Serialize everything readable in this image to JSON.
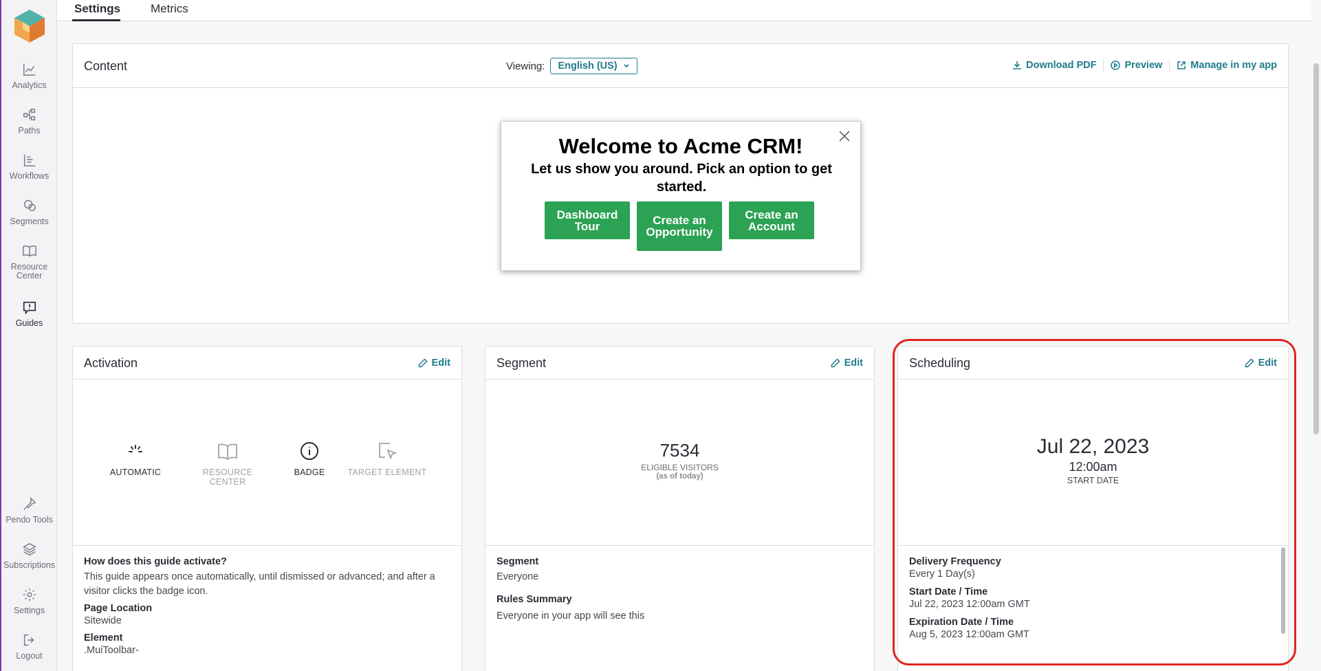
{
  "sidebar": {
    "items": [
      {
        "label": "Analytics",
        "icon": "chart-icon"
      },
      {
        "label": "Paths",
        "icon": "paths-icon"
      },
      {
        "label": "Workflows",
        "icon": "workflows-icon"
      },
      {
        "label": "Segments",
        "icon": "segments-icon"
      },
      {
        "label": "Resource Center",
        "icon": "book-icon"
      },
      {
        "label": "Guides",
        "icon": "guide-icon"
      }
    ],
    "bottom_items": [
      {
        "label": "Pendo Tools",
        "icon": "pin-icon"
      },
      {
        "label": "Subscriptions",
        "icon": "layers-icon"
      },
      {
        "label": "Settings",
        "icon": "gear-icon"
      },
      {
        "label": "Logout",
        "icon": "logout-icon"
      }
    ]
  },
  "tabs": [
    "Settings",
    "Metrics"
  ],
  "content": {
    "title": "Content",
    "viewing_label": "Viewing:",
    "language": "English (US)",
    "download_pdf": "Download PDF",
    "preview": "Preview",
    "manage": "Manage in my app",
    "guide": {
      "title": "Welcome to Acme CRM!",
      "subtitle": "Let us show you around. Pick an option to get started.",
      "buttons": [
        "Dashboard Tour",
        "Create an Opportunity",
        "Create an Account"
      ]
    }
  },
  "activation": {
    "title": "Activation",
    "edit": "Edit",
    "options": [
      {
        "label": "AUTOMATIC",
        "enabled": true
      },
      {
        "label": "RESOURCE CENTER",
        "enabled": false
      },
      {
        "label": "BADGE",
        "enabled": true
      },
      {
        "label": "TARGET ELEMENT",
        "enabled": false
      }
    ],
    "question": "How does this guide activate?",
    "description": "This guide appears once automatically, until dismissed or advanced; and after a visitor clicks the badge icon.",
    "page_location_label": "Page Location",
    "page_location": "Sitewide",
    "element_label": "Element",
    "element": ".MuiToolbar-"
  },
  "segment": {
    "title": "Segment",
    "edit": "Edit",
    "count": "7534",
    "count_label": "ELIGIBLE VISITORS",
    "count_sub": "(as of today)",
    "segment_label": "Segment",
    "segment_value": "Everyone",
    "rules_label": "Rules Summary",
    "rules_value": "Everyone in your app will see this"
  },
  "scheduling": {
    "title": "Scheduling",
    "edit": "Edit",
    "date": "Jul 22, 2023",
    "time": "12:00am",
    "date_label": "START DATE",
    "frequency_label": "Delivery Frequency",
    "frequency": "Every 1 Day(s)",
    "start_label": "Start Date / Time",
    "start": "Jul 22, 2023 12:00am GMT",
    "expiration_label": "Expiration Date / Time",
    "expiration": "Aug 5, 2023 12:00am GMT"
  },
  "colors": {
    "accent": "#1e7c8c",
    "guide_button": "#2ba254",
    "highlight": "#e0261d"
  }
}
